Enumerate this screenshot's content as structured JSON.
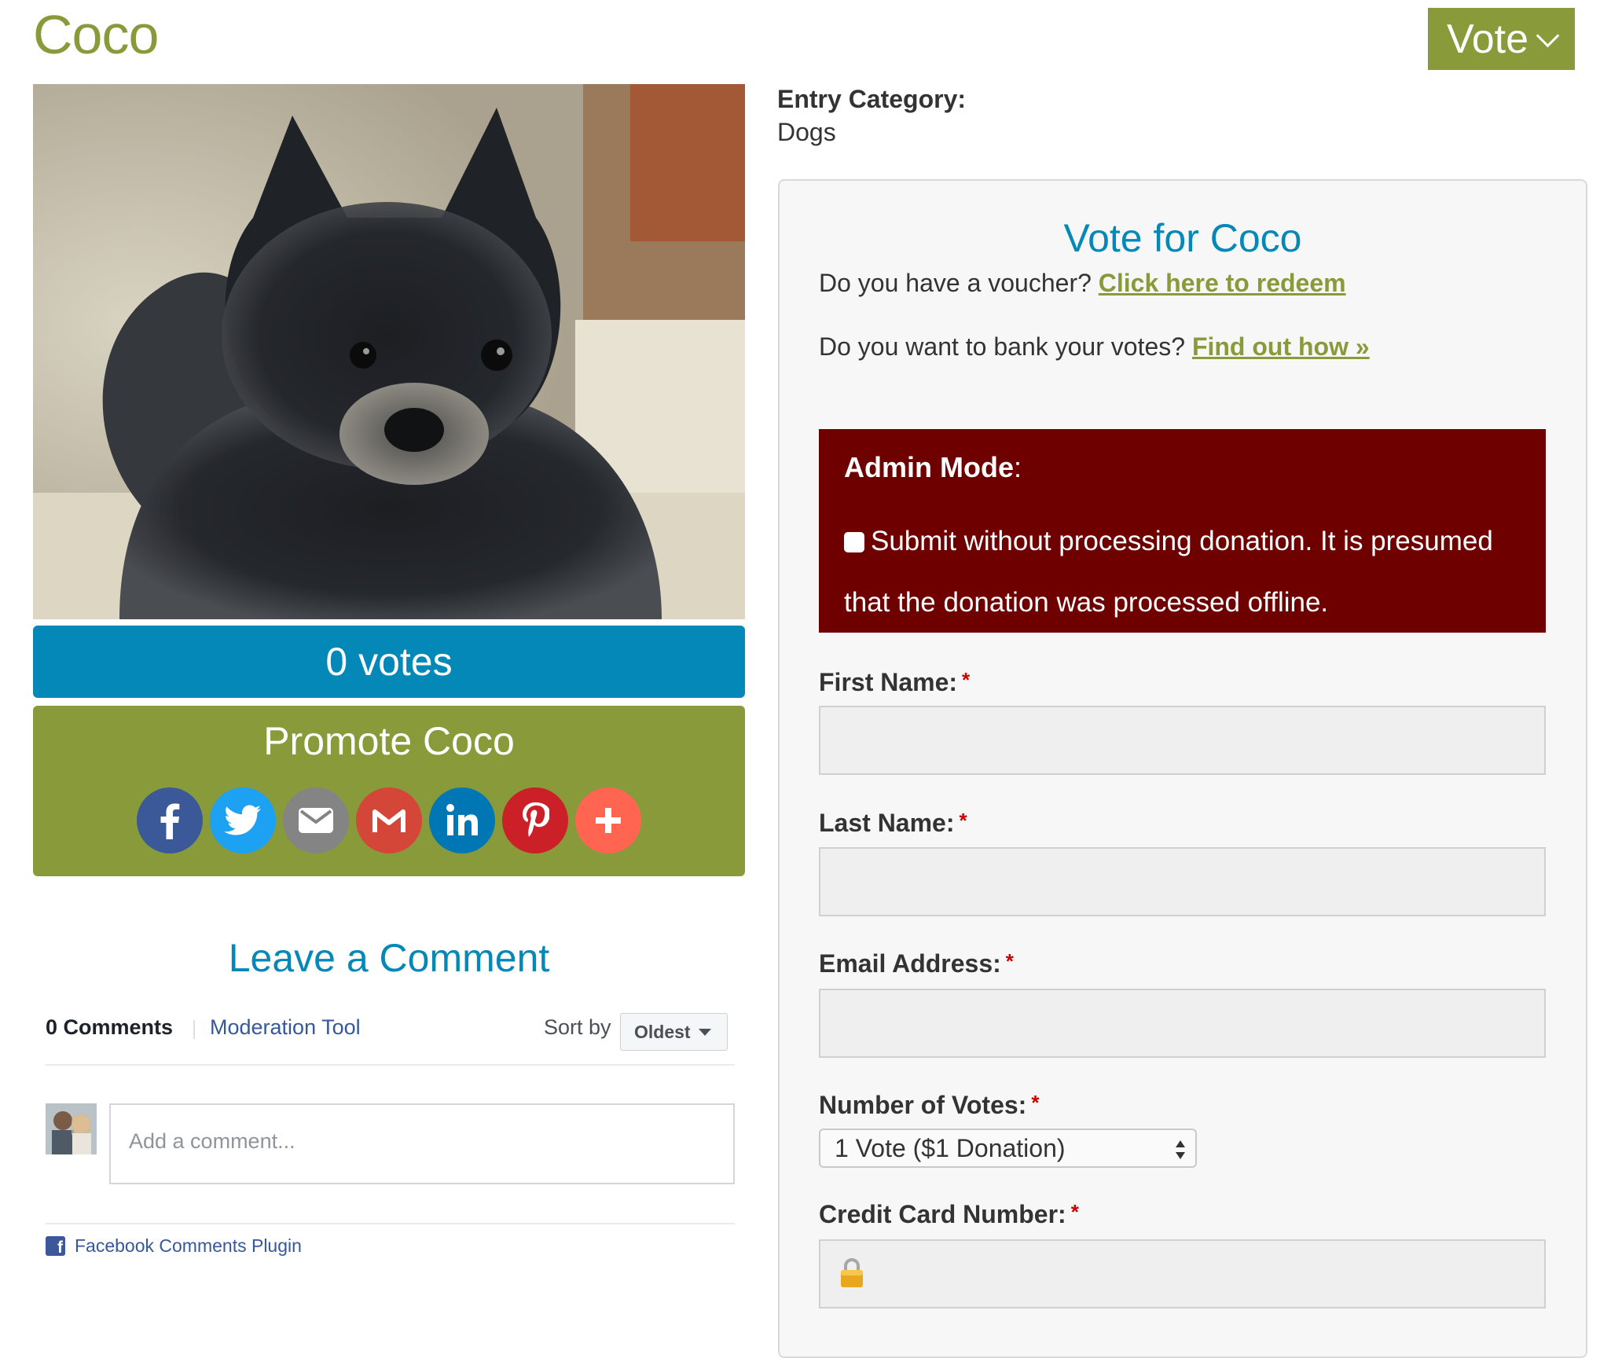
{
  "entry": {
    "title": "Coco"
  },
  "header": {
    "vote_label": "Vote"
  },
  "votes": {
    "label": "0 votes"
  },
  "promote": {
    "title": "Promote Coco",
    "share_buttons": [
      {
        "name": "facebook",
        "icon": "facebook-icon",
        "color": "#3b5998"
      },
      {
        "name": "twitter",
        "icon": "twitter-icon",
        "color": "#1da1f2"
      },
      {
        "name": "email",
        "icon": "email-icon",
        "color": "#848484"
      },
      {
        "name": "gmail",
        "icon": "gmail-icon",
        "color": "#d44638"
      },
      {
        "name": "linkedin",
        "icon": "linkedin-icon",
        "color": "#0077b5"
      },
      {
        "name": "pinterest",
        "icon": "pinterest-icon",
        "color": "#cb2027"
      },
      {
        "name": "more",
        "icon": "plus-icon",
        "color": "#ff6550"
      }
    ]
  },
  "comments": {
    "heading": "Leave a Comment",
    "count_label": "0 Comments",
    "moderation_label": "Moderation Tool",
    "sort_label": "Sort by",
    "sort_value": "Oldest",
    "input_placeholder": "Add a comment...",
    "plugin_label": "Facebook Comments Plugin"
  },
  "category": {
    "label": "Entry Category:",
    "value": "Dogs"
  },
  "vote_form": {
    "title": "Vote for Coco",
    "voucher_text": "Do you have a voucher?",
    "voucher_link": "Click here to redeem",
    "bank_text": "Do you want to bank your votes?",
    "bank_link": "Find out how »",
    "admin_title": "Admin Mode",
    "admin_colon": ":",
    "admin_checkbox_label": "Submit without processing donation. It is presumed that the donation was processed offline.",
    "fields": {
      "first_name": "First Name:",
      "last_name": "Last Name:",
      "email": "Email Address:",
      "num_votes": "Number of Votes:",
      "credit_card": "Credit Card Number:"
    },
    "required_mark": "*",
    "num_votes_value": "1 Vote ($1 Donation)",
    "colors": {
      "accent_green": "#899a3a",
      "accent_blue": "#0388b7",
      "admin_bg": "#6f0000"
    }
  }
}
